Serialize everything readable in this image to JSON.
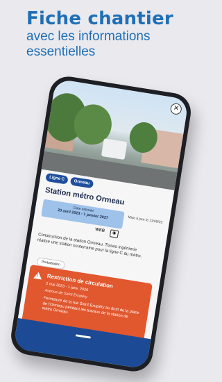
{
  "headline": {
    "title": "Fiche chantier",
    "subtitle_line1": "avec les informations",
    "subtitle_line2": "essentielles"
  },
  "card": {
    "chips": [
      "Ligne C",
      "Ormeau"
    ],
    "title": "Station métro Ormeau",
    "dates_label": "Date estimée",
    "dates_value": "20 avril 2023 - 1 janvier 2027",
    "updated": "Mise à jour le 11/09/23",
    "web_label": "WEB",
    "description": "Construction de la station Ormeau. Tisseo ingénierie réalise une station souterraine pour la ligne C du métro.",
    "perturbation_label": "Perturbation"
  },
  "alert": {
    "title": "Restriction de circulation",
    "date": "2 mai 2023 - 1 janv. 2026",
    "street": "Avenue de Saint Exupéry",
    "description": "Fermeture de la rue Saint Exupéry au droit de la place de l'Ormeau pendant les travaux de la station de métro Ormeau."
  },
  "icons": [
    "close-icon",
    "camera-icon",
    "warning-icon"
  ]
}
